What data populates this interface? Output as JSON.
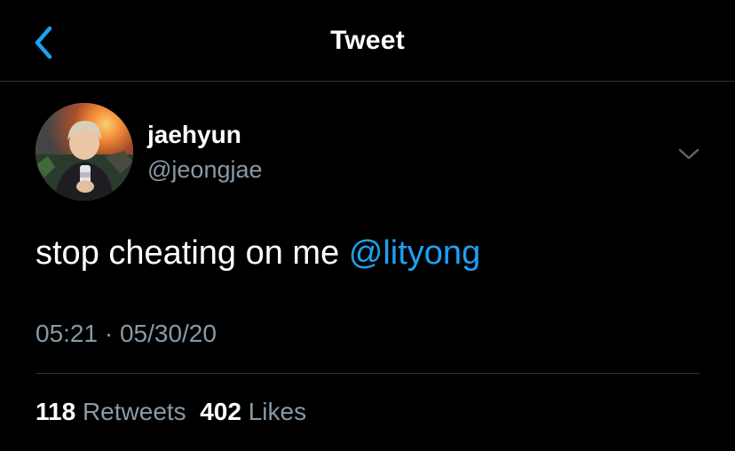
{
  "nav": {
    "title": "Tweet",
    "back_icon": "chevron-left-icon",
    "accent_color": "#1da1f2"
  },
  "tweet": {
    "author": {
      "name": "jaehyun",
      "handle": "@jeongjae"
    },
    "more_icon": "chevron-down-icon",
    "text_before_mention": "stop cheating on me ",
    "mention": "@lityong",
    "timestamp": "05:21 · 05/30/20",
    "stats": {
      "retweets_count": "118",
      "retweets_label": "Retweets",
      "likes_count": "402",
      "likes_label": "Likes"
    }
  },
  "colors": {
    "background": "#000000",
    "primary_text": "#ffffff",
    "secondary_text": "#8899a6",
    "link": "#1da1f2",
    "divider": "#2f3336"
  }
}
